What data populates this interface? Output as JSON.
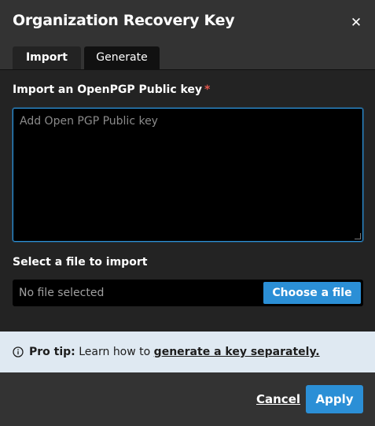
{
  "dialog": {
    "title": "Organization Recovery Key",
    "close_icon": "close-icon"
  },
  "tabs": [
    {
      "label": "Import",
      "active": true
    },
    {
      "label": "Generate",
      "active": false
    }
  ],
  "import": {
    "key_label": "Import an OpenPGP Public key",
    "required_mark": "*",
    "key_value": "",
    "key_placeholder": "Add Open PGP Public key",
    "file_label": "Select a file to import",
    "file_status": "No file selected",
    "choose_label": "Choose a file"
  },
  "tip": {
    "icon": "info-icon",
    "prefix": "Pro tip:",
    "text": "Learn how to",
    "link": "generate a key separately."
  },
  "footer": {
    "cancel_label": "Cancel",
    "apply_label": "Apply"
  },
  "colors": {
    "accent": "#2b8fd6",
    "required": "#e0564d",
    "dialog_bg": "#333333",
    "panel_bg": "#232323",
    "tip_bg": "#dfe9f2"
  }
}
